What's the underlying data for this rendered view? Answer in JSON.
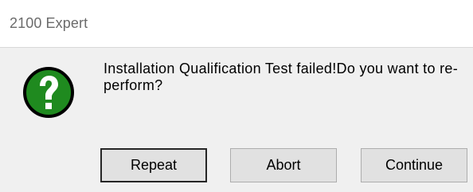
{
  "window": {
    "title": "2100 Expert"
  },
  "dialog": {
    "icon": "question-mark-icon",
    "message": "Installation Qualification Test failed!Do you want to re-perform?"
  },
  "buttons": {
    "repeat": "Repeat",
    "abort": "Abort",
    "continue": "Continue"
  },
  "colors": {
    "icon_green": "#1f8a1f",
    "icon_outline": "#000000",
    "dialog_bg": "#f0f0f0",
    "title_text": "#6b6b6b"
  }
}
